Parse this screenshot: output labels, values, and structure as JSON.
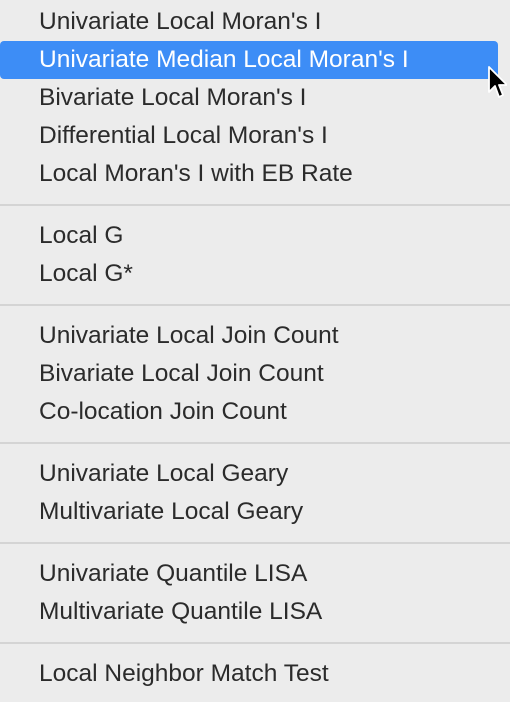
{
  "menu": {
    "groups": [
      {
        "items": [
          {
            "label": "Univariate Local Moran's I"
          },
          {
            "label": "Univariate Median Local Moran's I",
            "selected": true
          },
          {
            "label": "Bivariate Local Moran's I"
          },
          {
            "label": "Differential Local Moran's I"
          },
          {
            "label": "Local Moran's I with EB Rate"
          }
        ]
      },
      {
        "items": [
          {
            "label": "Local G"
          },
          {
            "label": "Local G*"
          }
        ]
      },
      {
        "items": [
          {
            "label": "Univariate Local Join Count"
          },
          {
            "label": "Bivariate Local Join Count"
          },
          {
            "label": "Co-location Join Count"
          }
        ]
      },
      {
        "items": [
          {
            "label": "Univariate Local Geary"
          },
          {
            "label": "Multivariate Local Geary"
          }
        ]
      },
      {
        "items": [
          {
            "label": "Univariate Quantile LISA"
          },
          {
            "label": "Multivariate Quantile LISA"
          }
        ]
      },
      {
        "items": [
          {
            "label": "Local Neighbor Match Test"
          }
        ]
      }
    ],
    "colors": {
      "background": "#ececec",
      "highlight": "#3d8df6",
      "text": "#2b2b2b",
      "separator": "#d4d4d4"
    },
    "cursor_icon": "arrow-cursor-icon"
  }
}
